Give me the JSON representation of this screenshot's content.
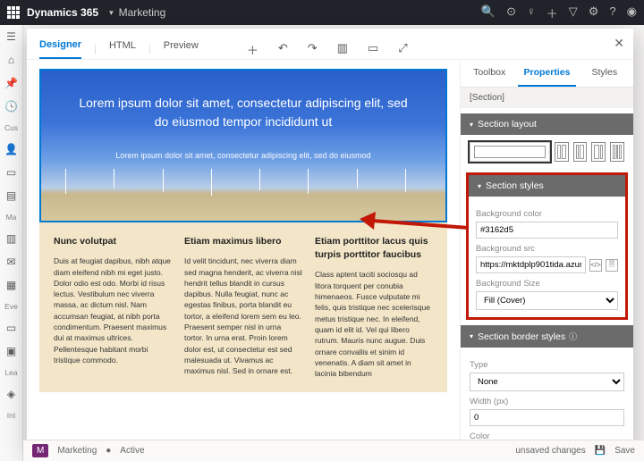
{
  "topbar": {
    "product": "Dynamics 365",
    "module": "Marketing"
  },
  "leftrail": {
    "groups": [
      "Cus",
      "Ma",
      "Eve",
      "Lea",
      "Int"
    ]
  },
  "modal": {
    "tabs": {
      "designer": "Designer",
      "html": "HTML",
      "preview": "Preview"
    },
    "section_label": "Section",
    "hero": {
      "heading": "Lorem ipsum dolor sit amet, consectetur adipiscing elit, sed do eiusmod tempor incididunt ut",
      "sub": "Lorem ipsum dolor sit amet, consectetur adipiscing elit, sed do eiusmod"
    },
    "columns": [
      {
        "h": "Nunc volutpat",
        "t": "Duis at feugiat dapibus, nibh atque diam eleifend nibh mi eget justo. Dolor odio est odo. Morbi id risus lectus. Vestibulum nec viverra massa, ac dictum nisl. Nam accumsan feugiat, at nibh porta condimentum. Praesent maximus dui at maximus ultrices. Pellentesque habitant morbi tristique commodo."
      },
      {
        "h": "Etiam maximus libero",
        "t": "Id velit tincidunt, nec viverra diam sed magna henderit, ac viverra nisl hendrit tellus blandit in cursus dapibus. Nulla feugiat, nunc ac egestas finibus, porta blandit eu tortor, a eleifend lorem sem eu leo. Praesent semper nisl in urna tortor. In urna erat. Proin lorem dolor est, ut consectetur est sed malesuada ut. Vivamus ac maximus nisl. Sed in ornare est."
      },
      {
        "h": "Etiam porttitor lacus quis turpis porttitor faucibus",
        "t": "Class aptent taciti sociosqu ad litora torquent per conubia himenaeos. Fusce vulputate mi felis, quis tristique nec scelerisque metus tristique nec. In eleifend, quam id elit id. Vel qui libero rutrum. Mauris nunc augue. Duis ornare convallis et sinim id venenatis. A diam sit amet in lacinia bibendum"
      }
    ],
    "properties": {
      "tabs": {
        "toolbox": "Toolbox",
        "properties": "Properties",
        "styles": "Styles"
      },
      "crumb": "[Section]",
      "layout_title": "Section layout",
      "styles_title": "Section styles",
      "bg_color_label": "Background color",
      "bg_color_value": "#3162d5",
      "bg_src_label": "Background src",
      "bg_src_value": "https://mktdplp901tida.azureedge.net/c",
      "bg_size_label": "Background Size",
      "bg_size_value": "Fill (Cover)",
      "border_title": "Section border styles",
      "type_label": "Type",
      "type_value": "None",
      "width_label": "Width (px)",
      "width_value": "0",
      "color_label": "Color"
    }
  },
  "bottombar": {
    "module": "Marketing",
    "status": "Active",
    "unsaved": "unsaved changes",
    "save": "Save"
  }
}
